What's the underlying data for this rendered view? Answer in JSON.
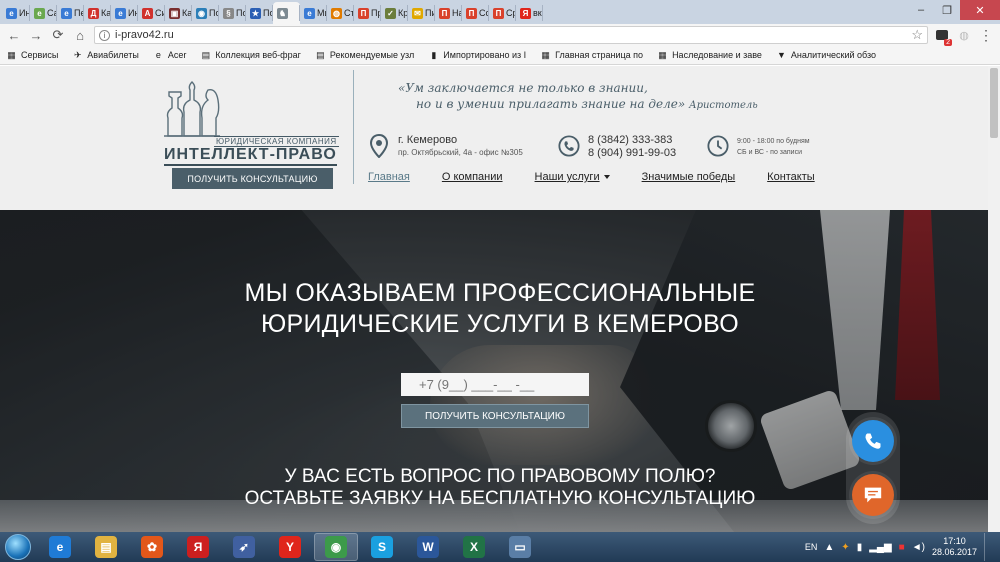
{
  "tabs": [
    {
      "title": "Ин",
      "icon": "e",
      "color": "#3a7bd5"
    },
    {
      "title": "Сам",
      "icon": "e",
      "color": "#6aa84f"
    },
    {
      "title": "Пер",
      "icon": "e",
      "color": "#3a7bd5"
    },
    {
      "title": "Кал",
      "icon": "Д",
      "color": "#d0312d"
    },
    {
      "title": "Ин",
      "icon": "e",
      "color": "#3a7bd5"
    },
    {
      "title": "Сит",
      "icon": "А",
      "color": "#d0312d"
    },
    {
      "title": "Как",
      "icon": "▣",
      "color": "#7a2f2f"
    },
    {
      "title": "По",
      "icon": "◉",
      "color": "#2c7fb8"
    },
    {
      "title": "По",
      "icon": "§",
      "color": "#888888"
    },
    {
      "title": "По",
      "icon": "★",
      "color": "#2b5fb4"
    },
    {
      "title": "",
      "icon": "♞",
      "color": "#7d8a92",
      "active": true
    },
    {
      "title": "Ми",
      "icon": "e",
      "color": "#3a7bd5"
    },
    {
      "title": "Сто",
      "icon": "◍",
      "color": "#e07b00"
    },
    {
      "title": "Пра",
      "icon": "П",
      "color": "#d9412b"
    },
    {
      "title": "Кра",
      "icon": "✓",
      "color": "#6b7d3b"
    },
    {
      "title": "Пис",
      "icon": "✉",
      "color": "#e0a800"
    },
    {
      "title": "Нач",
      "icon": "П",
      "color": "#d9412b"
    },
    {
      "title": "Сол",
      "icon": "П",
      "color": "#d9412b"
    },
    {
      "title": "Сре",
      "icon": "П",
      "color": "#d9412b"
    },
    {
      "title": "вкс",
      "icon": "Я",
      "color": "#e0251b"
    }
  ],
  "toolbar": {
    "url": "i-pravo42.ru",
    "back": "←",
    "forward": "→",
    "reload": "⟳",
    "home": "⌂",
    "info": "i",
    "star": "☆",
    "badge": "2"
  },
  "bookmarks": [
    {
      "label": "Сервисы",
      "icon": "▦"
    },
    {
      "label": "Авиабилеты",
      "icon": "✈"
    },
    {
      "label": "Acer",
      "icon": "e"
    },
    {
      "label": "Коллекция веб-фраг",
      "icon": "▤"
    },
    {
      "label": "Рекомендуемые узл",
      "icon": "▤"
    },
    {
      "label": "Импортировано из I",
      "icon": "▮"
    },
    {
      "label": "Главная страница по",
      "icon": "▦"
    },
    {
      "label": "Наследование и заве",
      "icon": "▦"
    },
    {
      "label": "Аналитический обзо",
      "icon": "▼"
    }
  ],
  "logo": {
    "small": "ЮРИДИЧЕСКАЯ КОМПАНИЯ",
    "name": "ИНТЕЛЛЕКТ-ПРАВО",
    "button": "ПОЛУЧИТЬ КОНСУЛЬТАЦИЮ"
  },
  "quote": {
    "line1": "«Ум заключается не только в знании,",
    "line2": "но и в умении прилагать знание на деле»",
    "author": "Аристотель"
  },
  "contacts": {
    "address_main": "г. Кемерово",
    "address_sub": "пр. Октябрьский, 4а - офис №305",
    "phone1": "8 (3842) 333-383",
    "phone2": "8 (904) 991-99-03",
    "hours1": "9:00 - 18:00 по будням",
    "hours2": "СБ и ВС - по записи"
  },
  "nav": [
    {
      "label": "Главная",
      "active": true
    },
    {
      "label": "О компании"
    },
    {
      "label": "Наши услуги",
      "dropdown": true
    },
    {
      "label": "Значимые победы"
    },
    {
      "label": "Контакты"
    }
  ],
  "hero": {
    "title1": "МЫ ОКАЗЫВАЕМ ПРОФЕССИОНАЛЬНЫЕ",
    "title2": "ЮРИДИЧЕСКИЕ УСЛУГИ В КЕМЕРОВО",
    "phone_placeholder": "+7 (9__) ___-__ -__",
    "button": "ПОЛУЧИТЬ КОНСУЛЬТАЦИЮ",
    "question1": "У ВАС ЕСТЬ ВОПРОС ПО ПРАВОВОМУ ПОЛЮ?",
    "question2": "ОСТАВЬТЕ ЗАЯВКУ НА БЕСПЛАТНУЮ КОНСУЛЬТАЦИЮ"
  },
  "taskbar": {
    "apps": [
      {
        "name": "ie",
        "icon": "e",
        "color": "#1f7bd6"
      },
      {
        "name": "explorer",
        "icon": "▤",
        "color": "#e1b341"
      },
      {
        "name": "game",
        "icon": "✿",
        "color": "#e2571a"
      },
      {
        "name": "yandex-market",
        "icon": "Я",
        "color": "#cc1f1f"
      },
      {
        "name": "rocket",
        "icon": "➶",
        "color": "#4060a0"
      },
      {
        "name": "yandex-browser",
        "icon": "Y",
        "color": "#e0251b"
      },
      {
        "name": "chrome",
        "icon": "◉",
        "color": "#3c9a4a",
        "active": true
      },
      {
        "name": "skype",
        "icon": "S",
        "color": "#1aa0e0"
      },
      {
        "name": "word",
        "icon": "W",
        "color": "#2b579a"
      },
      {
        "name": "excel",
        "icon": "X",
        "color": "#217346"
      },
      {
        "name": "picture",
        "icon": "▭",
        "color": "#5a7ea6"
      }
    ],
    "lang": "EN",
    "time": "17:10",
    "date": "28.06.2017"
  }
}
